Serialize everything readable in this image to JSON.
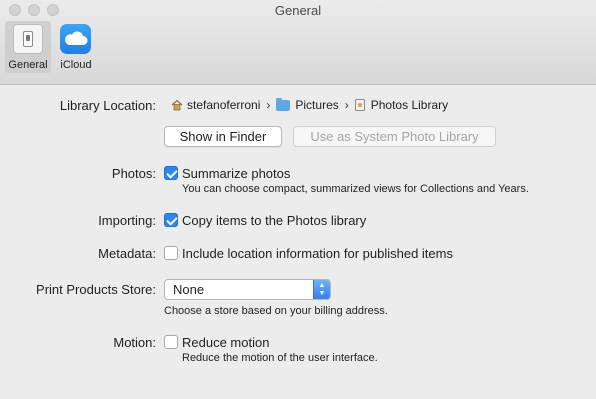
{
  "window": {
    "title": "General"
  },
  "toolbar": {
    "tabs": [
      {
        "label": "General",
        "icon": "general-switch-icon",
        "selected": true
      },
      {
        "label": "iCloud",
        "icon": "cloud-icon",
        "selected": false
      }
    ]
  },
  "library": {
    "label": "Library Location:",
    "path": [
      {
        "label": "stefanoferroni",
        "icon": "home-icon"
      },
      {
        "label": "Pictures",
        "icon": "folder-icon"
      },
      {
        "label": "Photos Library",
        "icon": "photos-library-icon"
      }
    ],
    "show_in_finder": "Show in Finder",
    "use_as_system": "Use as System Photo Library"
  },
  "photos": {
    "label": "Photos:",
    "checkbox_label": "Summarize photos",
    "checked": true,
    "help": "You can choose compact, summarized views for Collections and Years."
  },
  "importing": {
    "label": "Importing:",
    "checkbox_label": "Copy items to the Photos library",
    "checked": true
  },
  "metadata": {
    "label": "Metadata:",
    "checkbox_label": "Include location information for published items",
    "checked": false
  },
  "print_store": {
    "label": "Print Products Store:",
    "value": "None",
    "help": "Choose a store based on your billing address."
  },
  "motion": {
    "label": "Motion:",
    "checkbox_label": "Reduce motion",
    "checked": false,
    "help": "Reduce the motion of the user interface."
  },
  "colors": {
    "accent": "#2a87f5",
    "window_bg": "#ececec"
  }
}
